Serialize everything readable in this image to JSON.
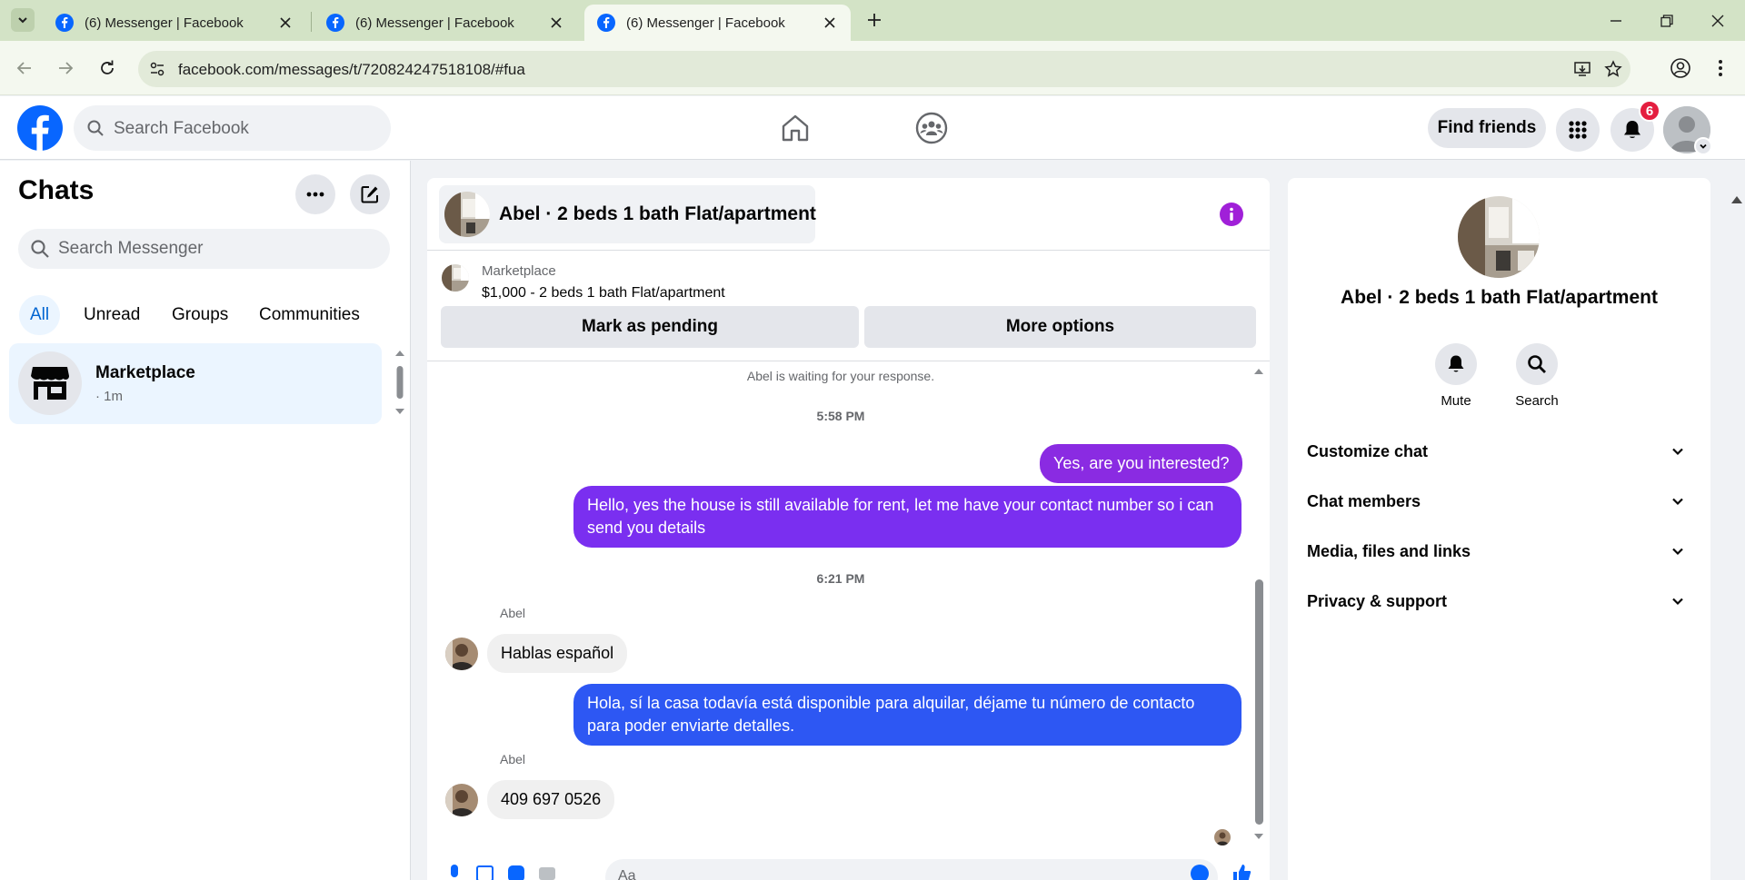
{
  "browser": {
    "tabs": [
      {
        "title": "(6) Messenger | Facebook",
        "active": false
      },
      {
        "title": "(6) Messenger | Facebook",
        "active": false
      },
      {
        "title": "(6) Messenger | Facebook",
        "active": true
      }
    ],
    "url": "facebook.com/messages/t/720824247518108/#fua"
  },
  "header": {
    "search_placeholder": "Search Facebook",
    "find_friends_label": "Find friends",
    "notification_count": "6"
  },
  "sidebar": {
    "title": "Chats",
    "search_placeholder": "Search Messenger",
    "filters": [
      "All",
      "Unread",
      "Groups",
      "Communities"
    ],
    "active_filter": "All",
    "chats": [
      {
        "name": "Marketplace",
        "time": "· 1m"
      }
    ]
  },
  "conversation": {
    "title": "Abel · 2 beds 1 bath Flat/apartment",
    "marketplace_label": "Marketplace",
    "listing": "$1,000 - 2 beds 1 bath Flat/apartment",
    "mark_pending_label": "Mark as pending",
    "more_options_label": "More options",
    "system_note": "Abel is waiting for your response.",
    "timestamps": [
      "5:58 PM",
      "6:21 PM"
    ],
    "messages": [
      {
        "from": "me",
        "text": "Yes, are you interested?"
      },
      {
        "from": "me",
        "text": "Hello, yes the house is still available for rent, let me have your contact number so i can send you details"
      },
      {
        "from": "Abel",
        "sender_label": "Abel",
        "text": "Hablas español"
      },
      {
        "from": "me",
        "text": "Hola, sí la casa todavía está disponible para alquilar, déjame tu número de contacto para poder enviarte detalles."
      },
      {
        "from": "Abel",
        "sender_label": "Abel",
        "text": "409 697 0526"
      }
    ],
    "composer_placeholder": "Aa"
  },
  "info_panel": {
    "title": "Abel · 2 beds 1 bath Flat/apartment",
    "actions": [
      "Mute",
      "Search"
    ],
    "sections": [
      "Customize chat",
      "Chat members",
      "Media, files and links",
      "Privacy & support"
    ]
  },
  "colors": {
    "facebook_blue": "#0866ff",
    "accent_purple": "#8a2be2",
    "accent_blue": "#2d57f3",
    "notification_red": "#e41e3f"
  }
}
